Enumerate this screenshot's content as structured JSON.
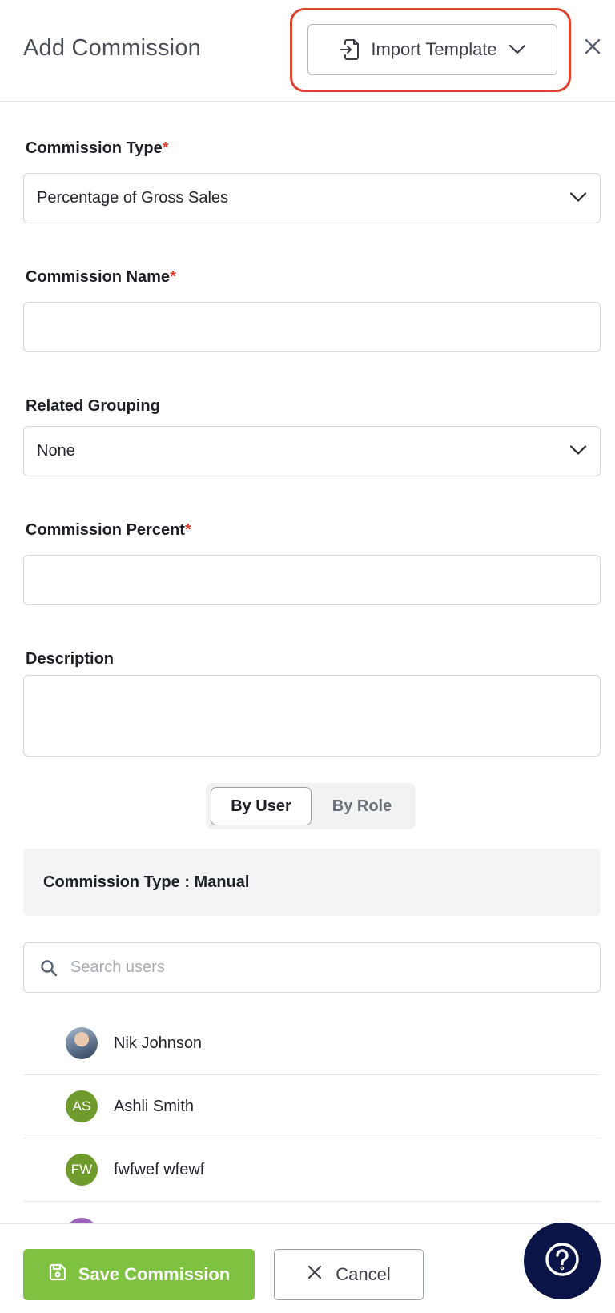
{
  "header": {
    "title": "Add Commission",
    "import_label": "Import Template"
  },
  "form": {
    "commission_type": {
      "label": "Commission Type",
      "required_mark": "*",
      "value": "Percentage of Gross Sales"
    },
    "commission_name": {
      "label": "Commission Name",
      "required_mark": "*",
      "value": ""
    },
    "related_grouping": {
      "label": "Related Grouping",
      "value": "None"
    },
    "commission_percent": {
      "label": "Commission Percent",
      "required_mark": "*",
      "value": ""
    },
    "description": {
      "label": "Description",
      "value": ""
    }
  },
  "toggle": {
    "by_user": "By User",
    "by_role": "By Role",
    "active": "by_user"
  },
  "banner": {
    "text": "Commission Type : Manual"
  },
  "search": {
    "placeholder": "Search users"
  },
  "users": [
    {
      "name": "Nik Johnson",
      "initials": "",
      "avatar": "photo"
    },
    {
      "name": "Ashli Smith",
      "initials": "AS",
      "avatar": "green"
    },
    {
      "name": "fwfwef wfewf",
      "initials": "FW",
      "avatar": "green"
    }
  ],
  "footer": {
    "save_label": "Save Commission",
    "cancel_label": "Cancel"
  },
  "colors": {
    "accent_green": "#7fc242",
    "highlight_red": "#e0402e",
    "help_navy": "#0b1446"
  }
}
